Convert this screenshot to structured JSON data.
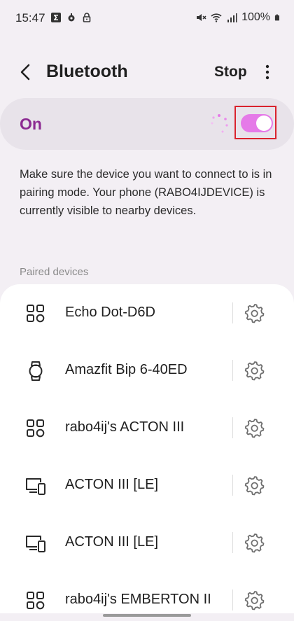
{
  "status_bar": {
    "time": "15:47",
    "battery": "100%"
  },
  "header": {
    "title": "Bluetooth",
    "stop_label": "Stop"
  },
  "bluetooth_toggle": {
    "label": "On",
    "state": "on",
    "accent_color": "#8c2a92",
    "toggle_color": "#e57ae8"
  },
  "description": "Make sure the device you want to connect to is in pairing mode. Your phone (RABO4IJDEVICE) is currently visible to nearby devices.",
  "paired_section": {
    "label": "Paired devices",
    "devices": [
      {
        "name": "Echo Dot-D6D",
        "icon": "apps-grid-icon"
      },
      {
        "name": "Amazfit Bip 6-40ED",
        "icon": "watch-icon"
      },
      {
        "name": "rabo4ij's ACTON III",
        "icon": "apps-grid-icon"
      },
      {
        "name": "ACTON III [LE]",
        "icon": "monitor-phone-icon"
      },
      {
        "name": "ACTON III [LE]",
        "icon": "monitor-phone-icon"
      },
      {
        "name": "rabo4ij's EMBERTON II",
        "icon": "apps-grid-icon"
      }
    ]
  }
}
